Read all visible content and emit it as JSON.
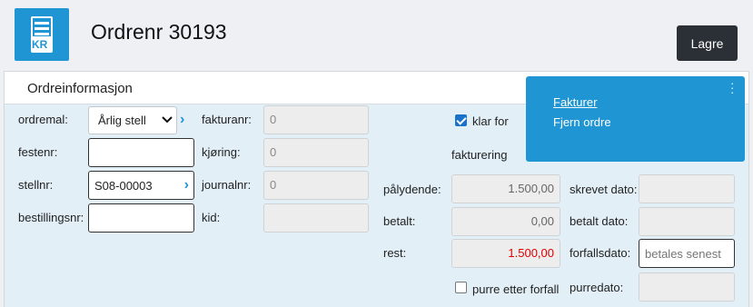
{
  "header": {
    "title": "Ordrenr 30193",
    "logo_text": "KR",
    "save_label": "Lagre"
  },
  "card": {
    "title": "Ordreinformasjon"
  },
  "form": {
    "ordremal_label": "ordremal:",
    "ordremal_value": "Årlig stell",
    "festenr_label": "festenr:",
    "festenr_value": "",
    "stellnr_label": "stellnr:",
    "stellnr_value": "S08-00003",
    "bestillingsnr_label": "bestillingsnr:",
    "bestillingsnr_value": "",
    "fakturanr_label": "fakturanr:",
    "fakturanr_value": "0",
    "kjoring_label": "kjøring:",
    "kjoring_value": "0",
    "journalnr_label": "journalnr:",
    "journalnr_value": "0",
    "kid_label": "kid:",
    "kid_value": "",
    "klar_label_1": "klar for",
    "klar_label_2": "fakturering",
    "klar_checked": true,
    "palydende_label": "pålydende:",
    "palydende_value": "1.500,00",
    "betalt_label": "betalt:",
    "betalt_value": "0,00",
    "rest_label": "rest:",
    "rest_value": "1.500,00",
    "purre_label": "purre etter forfall",
    "purre_checked": false,
    "skrevet_label": "skrevet dato:",
    "skrevet_value": "",
    "betalt_dato_label": "betalt dato:",
    "betalt_dato_value": "",
    "forfallsdato_label": "forfallsdato:",
    "forfallsdato_placeholder": "betales senest",
    "purredato_label": "purredato:",
    "purredato_value": ""
  },
  "actions": {
    "items": [
      "Fakturer",
      "Fjern ordre"
    ]
  },
  "colors": {
    "accent": "#1f96d3",
    "save_bg": "#2b2f36",
    "rest_red": "#e00000",
    "panel_bg": "#e2eff7"
  },
  "icons": {
    "logo": "invoice-kr-icon",
    "select": "chevron-down-icon",
    "go": "chevron-right-icon",
    "menu": "kebab-menu-icon"
  }
}
